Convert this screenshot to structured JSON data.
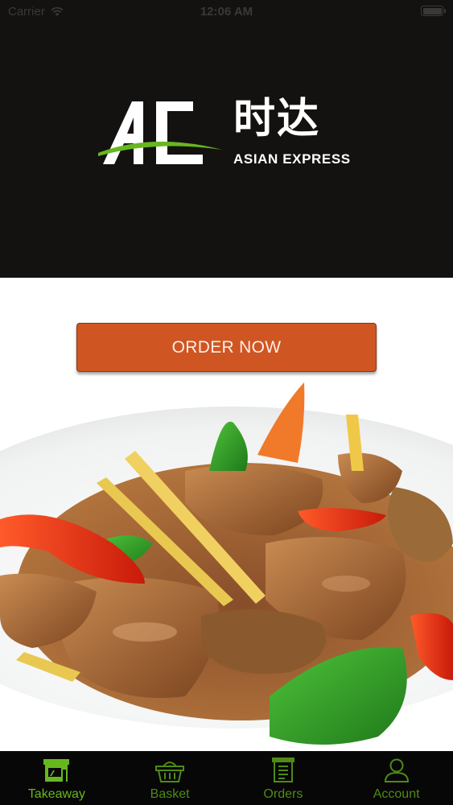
{
  "status_bar": {
    "carrier": "Carrier",
    "time": "12:06 AM",
    "battery_level": 1.0
  },
  "brand": {
    "logo_letters": "AE",
    "chinese_name": "时达",
    "english_name": "ASIAN EXPRESS",
    "accent_color": "#67b71f",
    "header_bg": "#141210"
  },
  "main": {
    "order_button_label": "ORDER NOW",
    "order_button_color": "#cf5522",
    "hero_image": "stir-fry-dish-photo"
  },
  "tab_bar": {
    "tabs": [
      {
        "label": "Takeaway",
        "icon": "storefront-icon",
        "active": true
      },
      {
        "label": "Basket",
        "icon": "basket-icon",
        "active": false
      },
      {
        "label": "Orders",
        "icon": "receipt-icon",
        "active": false
      },
      {
        "label": "Account",
        "icon": "user-icon",
        "active": false
      }
    ],
    "active_color": "#67b71f",
    "inactive_color": "#4f8a16"
  }
}
